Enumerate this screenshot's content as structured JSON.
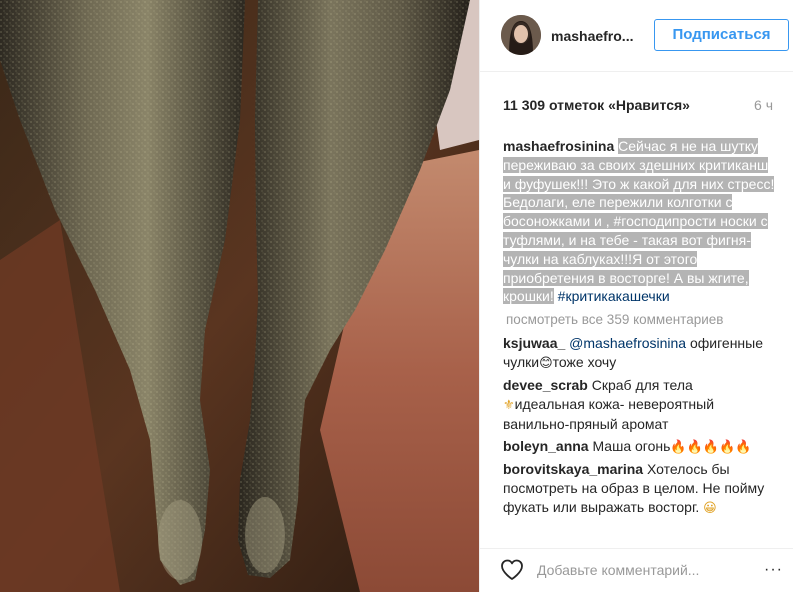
{
  "post": {
    "username": "mashaefro...",
    "follow_label": "Подписаться",
    "likes_text": "11 309 отметок «Нравится»",
    "time_text": "6 ч",
    "caption": {
      "username": "mashaefrosinina",
      "text": "Сейчас я не на шутку переживаю за своих здешних критиканш и фуфушек!!! Это ж какой для них стресс! Бедолаги, еле пережили колготки с босоножками и , #господипрости носки с туфлями, и на тебе - такая вот фигня- чулки на каблуках!!!Я от этого приобретения в восторге! А вы жгите, крошки!",
      "hashtag": "#критикакашечки"
    },
    "view_all_label": "посмотреть все 359 комментариев",
    "comments": [
      {
        "username": "ksjuwaa_",
        "mention": "@mashaefrosinina",
        "text": " офигенные чулки",
        "emoji": "😊",
        "text2": "тоже хочу"
      },
      {
        "username": "devee_scrab",
        "text": " Скраб для тела ",
        "emoji": "⚜",
        "text2": "идеальная кожа- невероятный ванильно-пряный аромат"
      },
      {
        "username": "boleyn_anna",
        "text": " Маша огонь",
        "emoji": "🔥🔥🔥🔥🔥",
        "text2": ""
      },
      {
        "username": "borovitskaya_marina",
        "text": " Хотелось бы посмотреть на образ в целом. Не пойму фукать или выражать восторг. ",
        "emoji": "😀",
        "text2": ""
      }
    ],
    "add_comment_placeholder": "Добавьте комментарий...",
    "more_label": "···",
    "heart_icon": "heart-icon",
    "colors": {
      "accent": "#3897f0",
      "link": "#003569",
      "muted": "#999999",
      "highlight": "#b4b4b4"
    }
  }
}
